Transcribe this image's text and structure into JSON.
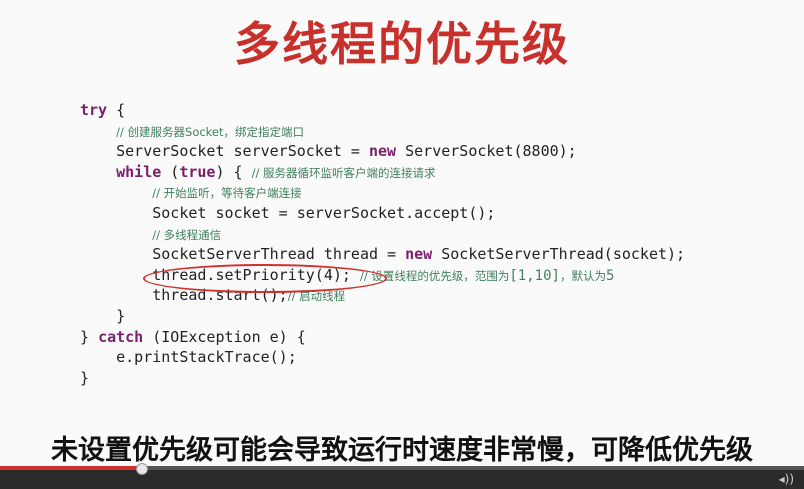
{
  "slide": {
    "title": "多线程的优先级"
  },
  "code": {
    "l1_kw": "try",
    "l1_rest": " {",
    "l2_comment": "// 创建服务器Socket，绑定指定端口",
    "l3_text": "ServerSocket serverSocket = ",
    "l3_kw": "new",
    "l3_rest": " ServerSocket(8800);",
    "l4_kw1": "while",
    "l4_mid": " (",
    "l4_kw2": "true",
    "l4_rest": ") { ",
    "l4_comment": "// 服务器循环监听客户端的连接请求",
    "l5_comment": "// 开始监听，等待客户端连接",
    "l6_text": "Socket socket = serverSocket.accept();",
    "l7_comment": "// 多线程通信",
    "l8_text": "SocketServerThread thread = ",
    "l8_kw": "new",
    "l8_rest": " SocketServerThread(socket);",
    "l9_text": "thread.setPriority(4);",
    "l9_comment1": "// 设置线程的优先级，范围为",
    "l9_range": "[1,10]",
    "l9_comment2": "，默认为",
    "l9_default": "5",
    "l10_text": "thread.start();",
    "l10_comment": "// 启动线程",
    "l11_text": "}",
    "l12_open": "} ",
    "l12_kw": "catch",
    "l12_rest": " (IOException e) {",
    "l13_text": "e.printStackTrace();",
    "l14_text": "}"
  },
  "subtitle": "未设置优先级可能会导致运行时速度非常慢，可降低优先级",
  "player": {
    "progress": 0.175,
    "volume_label": "◂))"
  }
}
